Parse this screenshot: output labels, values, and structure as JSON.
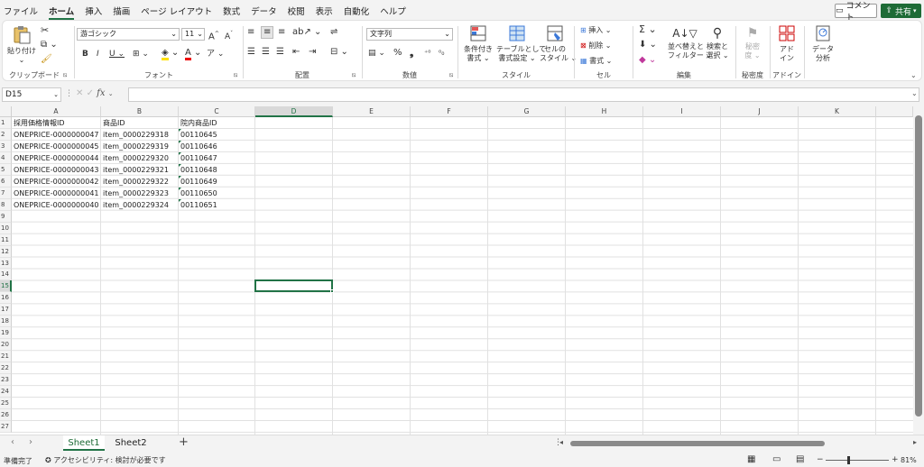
{
  "menu": {
    "tabs": [
      "ファイル",
      "ホーム",
      "挿入",
      "描画",
      "ページ レイアウト",
      "数式",
      "データ",
      "校閲",
      "表示",
      "自動化",
      "ヘルプ"
    ],
    "active": "ホーム",
    "comment_label": "コメント",
    "share_label": "共有"
  },
  "ribbon": {
    "clipboard": {
      "paste_label": "貼り付け",
      "group_label": "クリップボード"
    },
    "font": {
      "font_name": "游ゴシック",
      "font_size": "11",
      "group_label": "フォント"
    },
    "alignment": {
      "group_label": "配置"
    },
    "number": {
      "format": "文字列",
      "group_label": "数値"
    },
    "styles": {
      "conditional_label1": "条件付き",
      "conditional_label2": "書式",
      "table_label1": "テーブルとして",
      "table_label2": "書式設定",
      "cellstyle_label1": "セルの",
      "cellstyle_label2": "スタイル",
      "group_label": "スタイル"
    },
    "cells": {
      "insert_label": "挿入",
      "delete_label": "削除",
      "format_label": "書式",
      "group_label": "セル"
    },
    "editing": {
      "sort_label1": "並べ替えと",
      "sort_label2": "フィルター",
      "find_label1": "検索と",
      "find_label2": "選択",
      "group_label": "編集"
    },
    "sensitivity": {
      "label1": "秘密",
      "label2": "度",
      "group_label": "秘密度"
    },
    "addins": {
      "label1": "アド",
      "label2": "イン",
      "group_label": "アドイン"
    },
    "analysis": {
      "label1": "データ",
      "label2": "分析"
    }
  },
  "formula_bar": {
    "name_box": "D15",
    "fx": "fx",
    "formula": ""
  },
  "grid": {
    "columns": [
      "A",
      "B",
      "C",
      "D",
      "E",
      "F",
      "G",
      "H",
      "I",
      "J",
      "K"
    ],
    "selected_column": "D",
    "selected_row": 15,
    "row_count": 27,
    "cells": [
      [
        "採用価格情報ID",
        "商品ID",
        "院内商品ID"
      ],
      [
        "ONEPRICE-0000000047",
        "item_0000229318",
        "00110645"
      ],
      [
        "ONEPRICE-0000000045",
        "item_0000229319",
        "00110646"
      ],
      [
        "ONEPRICE-0000000044",
        "item_0000229320",
        "00110647"
      ],
      [
        "ONEPRICE-0000000043",
        "item_0000229321",
        "00110648"
      ],
      [
        "ONEPRICE-0000000042",
        "item_0000229322",
        "00110649"
      ],
      [
        "ONEPRICE-0000000041",
        "item_0000229323",
        "00110650"
      ],
      [
        "ONEPRICE-0000000040",
        "item_0000229324",
        "00110651"
      ]
    ]
  },
  "sheets": {
    "tabs": [
      "Sheet1",
      "Sheet2"
    ],
    "active": "Sheet1",
    "add": "+"
  },
  "status": {
    "ready": "準備完了",
    "accessibility": "アクセシビリティ: 検討が必要です",
    "zoom": "81%"
  },
  "colors": {
    "accent": "#217346",
    "share": "#1e6b36"
  }
}
